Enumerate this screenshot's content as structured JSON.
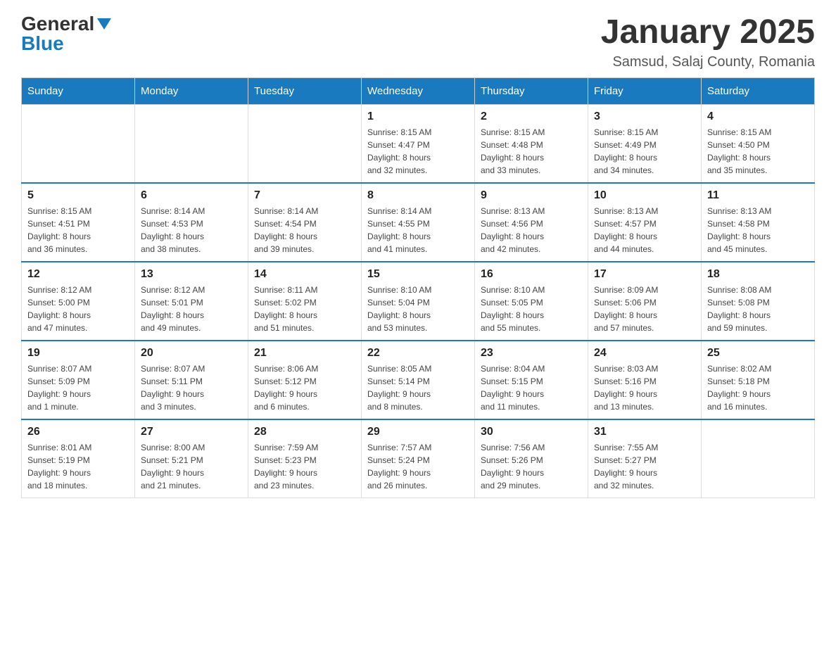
{
  "logo": {
    "general": "General",
    "blue": "Blue"
  },
  "title": "January 2025",
  "subtitle": "Samsud, Salaj County, Romania",
  "weekdays": [
    "Sunday",
    "Monday",
    "Tuesday",
    "Wednesday",
    "Thursday",
    "Friday",
    "Saturday"
  ],
  "weeks": [
    [
      {
        "day": "",
        "info": ""
      },
      {
        "day": "",
        "info": ""
      },
      {
        "day": "",
        "info": ""
      },
      {
        "day": "1",
        "info": "Sunrise: 8:15 AM\nSunset: 4:47 PM\nDaylight: 8 hours\nand 32 minutes."
      },
      {
        "day": "2",
        "info": "Sunrise: 8:15 AM\nSunset: 4:48 PM\nDaylight: 8 hours\nand 33 minutes."
      },
      {
        "day": "3",
        "info": "Sunrise: 8:15 AM\nSunset: 4:49 PM\nDaylight: 8 hours\nand 34 minutes."
      },
      {
        "day": "4",
        "info": "Sunrise: 8:15 AM\nSunset: 4:50 PM\nDaylight: 8 hours\nand 35 minutes."
      }
    ],
    [
      {
        "day": "5",
        "info": "Sunrise: 8:15 AM\nSunset: 4:51 PM\nDaylight: 8 hours\nand 36 minutes."
      },
      {
        "day": "6",
        "info": "Sunrise: 8:14 AM\nSunset: 4:53 PM\nDaylight: 8 hours\nand 38 minutes."
      },
      {
        "day": "7",
        "info": "Sunrise: 8:14 AM\nSunset: 4:54 PM\nDaylight: 8 hours\nand 39 minutes."
      },
      {
        "day": "8",
        "info": "Sunrise: 8:14 AM\nSunset: 4:55 PM\nDaylight: 8 hours\nand 41 minutes."
      },
      {
        "day": "9",
        "info": "Sunrise: 8:13 AM\nSunset: 4:56 PM\nDaylight: 8 hours\nand 42 minutes."
      },
      {
        "day": "10",
        "info": "Sunrise: 8:13 AM\nSunset: 4:57 PM\nDaylight: 8 hours\nand 44 minutes."
      },
      {
        "day": "11",
        "info": "Sunrise: 8:13 AM\nSunset: 4:58 PM\nDaylight: 8 hours\nand 45 minutes."
      }
    ],
    [
      {
        "day": "12",
        "info": "Sunrise: 8:12 AM\nSunset: 5:00 PM\nDaylight: 8 hours\nand 47 minutes."
      },
      {
        "day": "13",
        "info": "Sunrise: 8:12 AM\nSunset: 5:01 PM\nDaylight: 8 hours\nand 49 minutes."
      },
      {
        "day": "14",
        "info": "Sunrise: 8:11 AM\nSunset: 5:02 PM\nDaylight: 8 hours\nand 51 minutes."
      },
      {
        "day": "15",
        "info": "Sunrise: 8:10 AM\nSunset: 5:04 PM\nDaylight: 8 hours\nand 53 minutes."
      },
      {
        "day": "16",
        "info": "Sunrise: 8:10 AM\nSunset: 5:05 PM\nDaylight: 8 hours\nand 55 minutes."
      },
      {
        "day": "17",
        "info": "Sunrise: 8:09 AM\nSunset: 5:06 PM\nDaylight: 8 hours\nand 57 minutes."
      },
      {
        "day": "18",
        "info": "Sunrise: 8:08 AM\nSunset: 5:08 PM\nDaylight: 8 hours\nand 59 minutes."
      }
    ],
    [
      {
        "day": "19",
        "info": "Sunrise: 8:07 AM\nSunset: 5:09 PM\nDaylight: 9 hours\nand 1 minute."
      },
      {
        "day": "20",
        "info": "Sunrise: 8:07 AM\nSunset: 5:11 PM\nDaylight: 9 hours\nand 3 minutes."
      },
      {
        "day": "21",
        "info": "Sunrise: 8:06 AM\nSunset: 5:12 PM\nDaylight: 9 hours\nand 6 minutes."
      },
      {
        "day": "22",
        "info": "Sunrise: 8:05 AM\nSunset: 5:14 PM\nDaylight: 9 hours\nand 8 minutes."
      },
      {
        "day": "23",
        "info": "Sunrise: 8:04 AM\nSunset: 5:15 PM\nDaylight: 9 hours\nand 11 minutes."
      },
      {
        "day": "24",
        "info": "Sunrise: 8:03 AM\nSunset: 5:16 PM\nDaylight: 9 hours\nand 13 minutes."
      },
      {
        "day": "25",
        "info": "Sunrise: 8:02 AM\nSunset: 5:18 PM\nDaylight: 9 hours\nand 16 minutes."
      }
    ],
    [
      {
        "day": "26",
        "info": "Sunrise: 8:01 AM\nSunset: 5:19 PM\nDaylight: 9 hours\nand 18 minutes."
      },
      {
        "day": "27",
        "info": "Sunrise: 8:00 AM\nSunset: 5:21 PM\nDaylight: 9 hours\nand 21 minutes."
      },
      {
        "day": "28",
        "info": "Sunrise: 7:59 AM\nSunset: 5:23 PM\nDaylight: 9 hours\nand 23 minutes."
      },
      {
        "day": "29",
        "info": "Sunrise: 7:57 AM\nSunset: 5:24 PM\nDaylight: 9 hours\nand 26 minutes."
      },
      {
        "day": "30",
        "info": "Sunrise: 7:56 AM\nSunset: 5:26 PM\nDaylight: 9 hours\nand 29 minutes."
      },
      {
        "day": "31",
        "info": "Sunrise: 7:55 AM\nSunset: 5:27 PM\nDaylight: 9 hours\nand 32 minutes."
      },
      {
        "day": "",
        "info": ""
      }
    ]
  ]
}
